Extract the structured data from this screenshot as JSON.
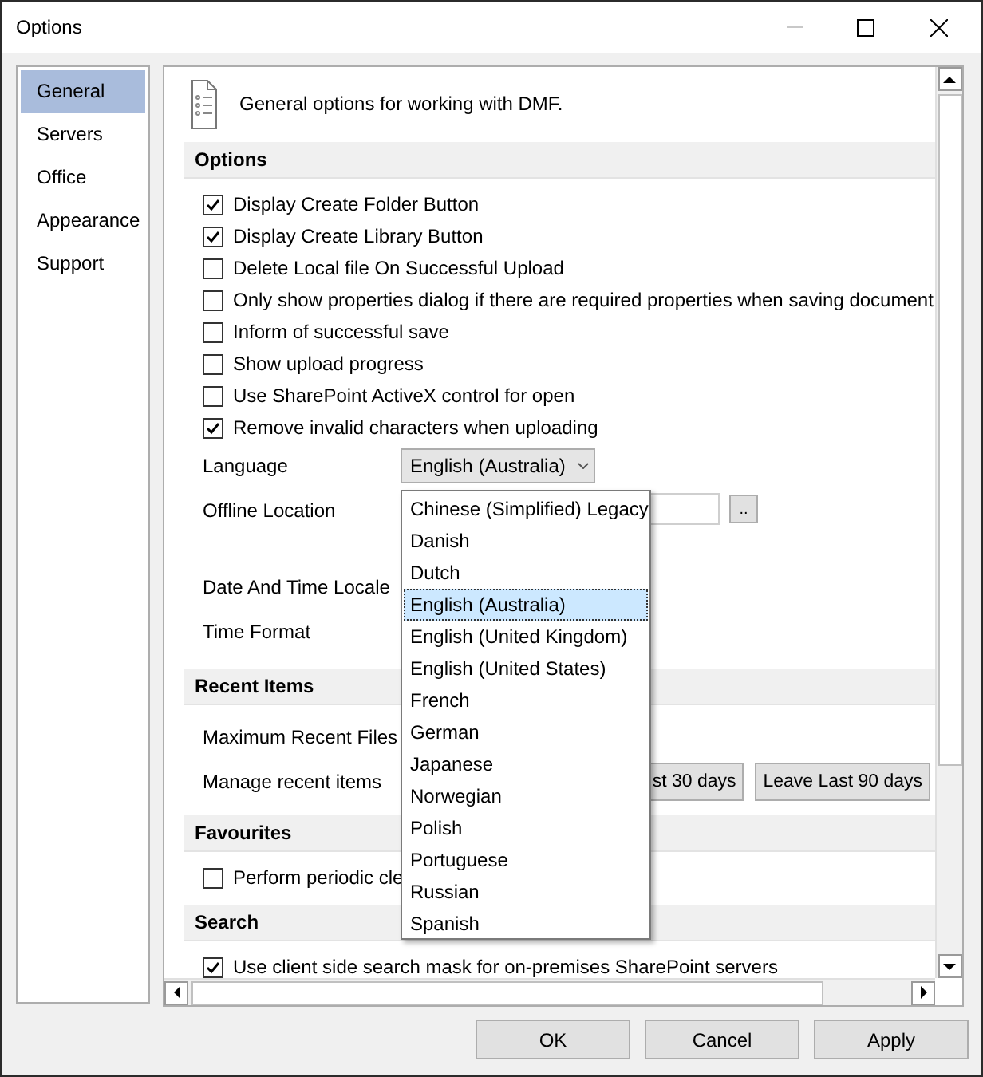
{
  "window": {
    "title": "Options"
  },
  "sidebar": {
    "items": [
      {
        "label": "General",
        "selected": true
      },
      {
        "label": "Servers",
        "selected": false
      },
      {
        "label": "Office",
        "selected": false
      },
      {
        "label": "Appearance",
        "selected": false
      },
      {
        "label": "Support",
        "selected": false
      }
    ]
  },
  "intro": {
    "text": "General options for working with DMF."
  },
  "sections": [
    {
      "title": "Options",
      "rows": [
        {
          "kind": "checkbox",
          "label": "Display Create Folder Button",
          "checked": true
        },
        {
          "kind": "checkbox",
          "label": "Display Create Library Button",
          "checked": true
        },
        {
          "kind": "checkbox",
          "label": "Delete Local file On Successful Upload",
          "checked": false
        },
        {
          "kind": "checkbox",
          "label": "Only show properties dialog if there are required properties when saving document",
          "checked": false
        },
        {
          "kind": "checkbox",
          "label": "Inform of successful save",
          "checked": false
        },
        {
          "kind": "checkbox",
          "label": "Show upload progress",
          "checked": false
        },
        {
          "kind": "checkbox",
          "label": "Use SharePoint ActiveX control for open",
          "checked": false
        },
        {
          "kind": "checkbox",
          "label": "Remove invalid characters when uploading",
          "checked": true
        },
        {
          "kind": "combo",
          "label": "Language",
          "value": "English (Australia)"
        },
        {
          "kind": "path",
          "label": "Offline Location",
          "button": ".."
        },
        {
          "kind": "label",
          "label": "Date And Time Locale"
        },
        {
          "kind": "label",
          "label": "Time Format"
        }
      ]
    },
    {
      "title": "Recent Items",
      "rows": [
        {
          "kind": "label",
          "label": "Maximum Recent Files"
        },
        {
          "kind": "buttons",
          "label": "Manage recent items",
          "buttons": [
            "st 30 days",
            "Leave Last 90 days"
          ]
        }
      ]
    },
    {
      "title": "Favourites",
      "rows": [
        {
          "kind": "checkbox",
          "label": "Perform periodic cle",
          "checked": false
        }
      ]
    },
    {
      "title": "Search",
      "rows": [
        {
          "kind": "checkbox",
          "label": "Use client side search mask for on-premises SharePoint servers",
          "checked": true
        }
      ]
    }
  ],
  "dropdown": {
    "items": [
      {
        "label": "Chinese (Simplified) Legacy",
        "selected": false
      },
      {
        "label": "Danish",
        "selected": false
      },
      {
        "label": "Dutch",
        "selected": false
      },
      {
        "label": "English (Australia)",
        "selected": true
      },
      {
        "label": "English (United Kingdom)",
        "selected": false
      },
      {
        "label": "English (United States)",
        "selected": false
      },
      {
        "label": "French",
        "selected": false
      },
      {
        "label": "German",
        "selected": false
      },
      {
        "label": "Japanese",
        "selected": false
      },
      {
        "label": "Norwegian",
        "selected": false
      },
      {
        "label": "Polish",
        "selected": false
      },
      {
        "label": "Portuguese",
        "selected": false
      },
      {
        "label": "Russian",
        "selected": false
      },
      {
        "label": "Spanish",
        "selected": false
      }
    ]
  },
  "buttons": [
    {
      "label": "OK"
    },
    {
      "label": "Cancel"
    },
    {
      "label": "Apply"
    }
  ]
}
